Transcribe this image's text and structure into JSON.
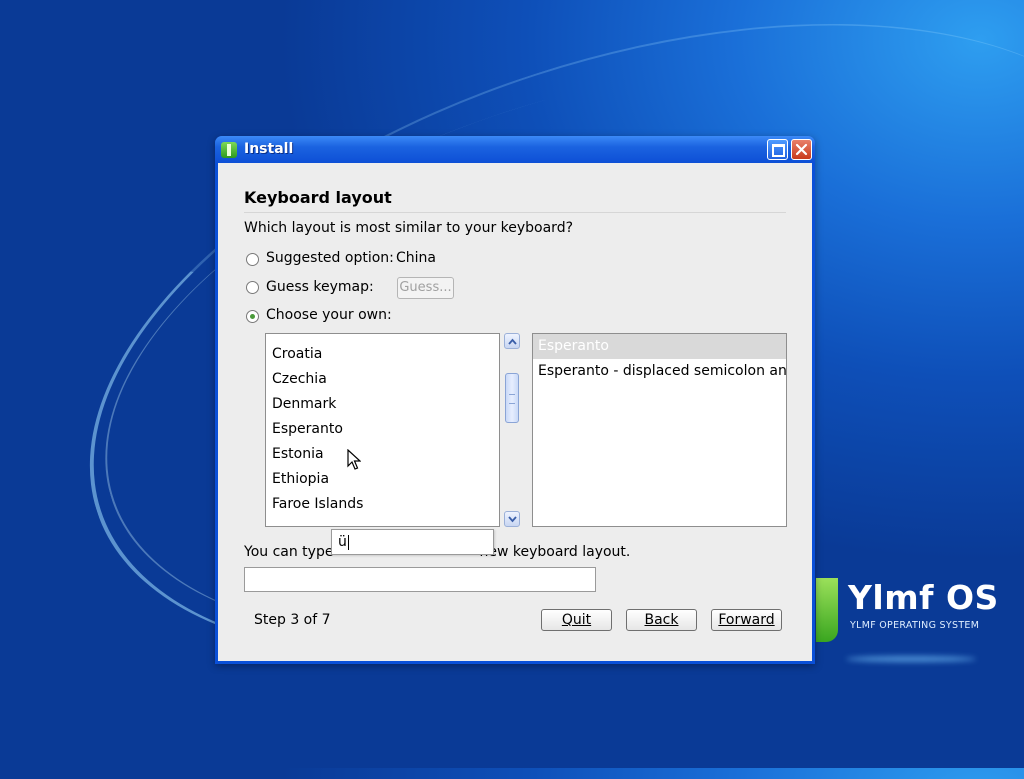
{
  "window": {
    "title": "Install"
  },
  "page": {
    "heading": "Keyboard layout",
    "question": "Which layout is most similar to your keyboard?"
  },
  "options": {
    "suggested_label": "Suggested option:",
    "suggested_value": "China",
    "guess_label": "Guess keymap:",
    "guess_button": "Guess...",
    "choose_label": "Choose your own:",
    "selected": "choose"
  },
  "layouts": [
    {
      "label": "Croatia"
    },
    {
      "label": "Czechia"
    },
    {
      "label": "Denmark"
    },
    {
      "label": "Esperanto"
    },
    {
      "label": "Estonia"
    },
    {
      "label": "Ethiopia"
    },
    {
      "label": "Faroe Islands"
    }
  ],
  "variants": [
    {
      "label": "Esperanto",
      "selected": true
    },
    {
      "label": "Esperanto - displaced semicolon and quote (obsolete)",
      "selected": false
    }
  ],
  "typeahead": {
    "value": "ü"
  },
  "hint": {
    "left": "You can type",
    "right": "new keyboard layout."
  },
  "test_field": {
    "value": ""
  },
  "footer": {
    "step": "Step 3 of 7",
    "quit": "Quit",
    "back": "Back",
    "forward": "Forward"
  },
  "branding": {
    "name": "Ylmf OS",
    "tagline": "YLMF OPERATING SYSTEM"
  }
}
